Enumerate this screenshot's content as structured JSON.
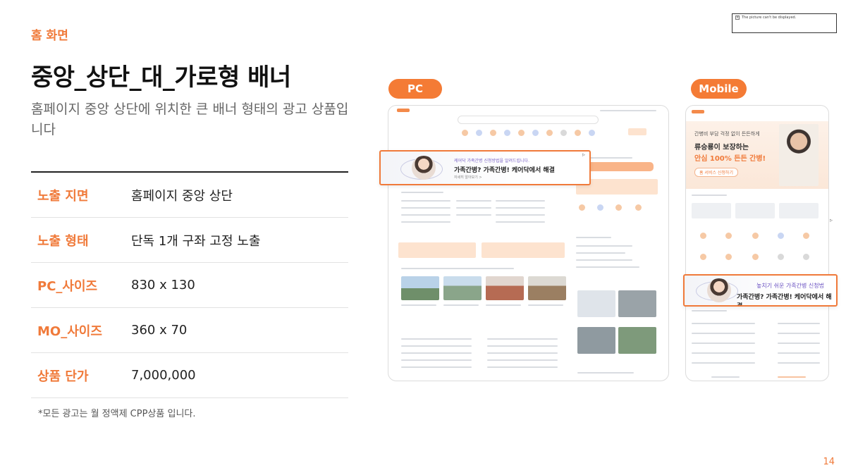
{
  "header": {
    "eyebrow": "홈 화면",
    "title": "중앙_상단_대_가로형 배너",
    "description": "홈페이지 중앙 상단에 위치한 큰 배너 형태의 광고 상품입니다"
  },
  "specs": [
    {
      "label": "노출 지면",
      "value": "홈페이지 중앙 상단"
    },
    {
      "label": "노출 형태",
      "value": "단독 1개 구좌 고정 노출"
    },
    {
      "label": "PC_사이즈",
      "value": "830 x 130"
    },
    {
      "label": "MO_사이즈",
      "value": "360 x 70"
    },
    {
      "label": "상품 단가",
      "value": "7,000,000"
    }
  ],
  "footnote": "*모든 광고는 월 정액제 CPP상품 입니다.",
  "page_number": "14",
  "broken_image_text": "The picture can't be displayed.",
  "previews": {
    "pc_label": "PC",
    "mobile_label": "Mobile"
  },
  "pc_banner": {
    "sub": "케어닥 가족간병 신청방법을 알려드립니다.",
    "main": "가족간병? 가족간병! 케어닥에서 해결",
    "link": "자세히 알아보기 >"
  },
  "mobile_banner": {
    "sub": "놓치기 쉬운 가족간병 신청법",
    "main": "가족간병? 가족간병! 케어닥에서 해결"
  },
  "mobile_hero": {
    "line1": "간병비 부담 걱정 없이 든든하게",
    "line2": "류승룡이 보장하는",
    "line3": "안심 100% 든든 간병!",
    "cta": "홈 서비스 신청하기"
  },
  "colors": {
    "accent": "#f07a3a",
    "pill": "#f47b35",
    "text": "#222222",
    "muted": "#666666"
  },
  "icons": {
    "broken_image": "broken-image-icon",
    "ad_marker": "ad-marker-icon"
  }
}
